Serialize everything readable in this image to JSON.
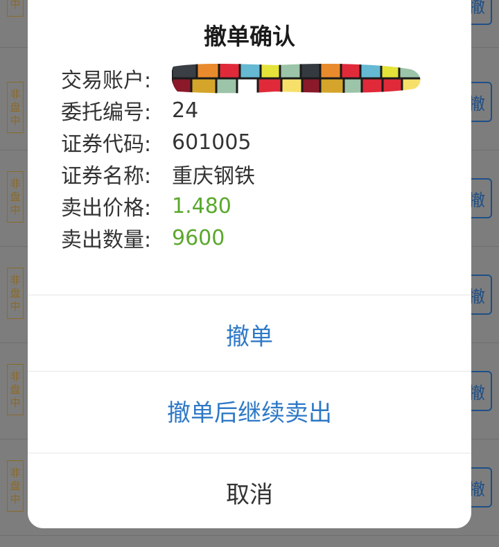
{
  "background": {
    "row_tag": [
      "非",
      "盘",
      "中"
    ],
    "row_button_char": "撤"
  },
  "dialog": {
    "title": "撤单确认",
    "fields": [
      {
        "label": "交易账户:",
        "value": "",
        "redacted": true
      },
      {
        "label": "委托编号:",
        "value": "24"
      },
      {
        "label": "证券代码:",
        "value": "601005"
      },
      {
        "label": "证券名称:",
        "value": "重庆钢铁"
      },
      {
        "label": "卖出价格:",
        "value": "1.480",
        "color": "#5aa82c"
      },
      {
        "label": "卖出数量:",
        "value": "9600",
        "color": "#5aa82c"
      }
    ],
    "actions": {
      "cancel_order": "撤单",
      "cancel_and_sell": "撤单后继续卖出",
      "close": "取消"
    }
  }
}
